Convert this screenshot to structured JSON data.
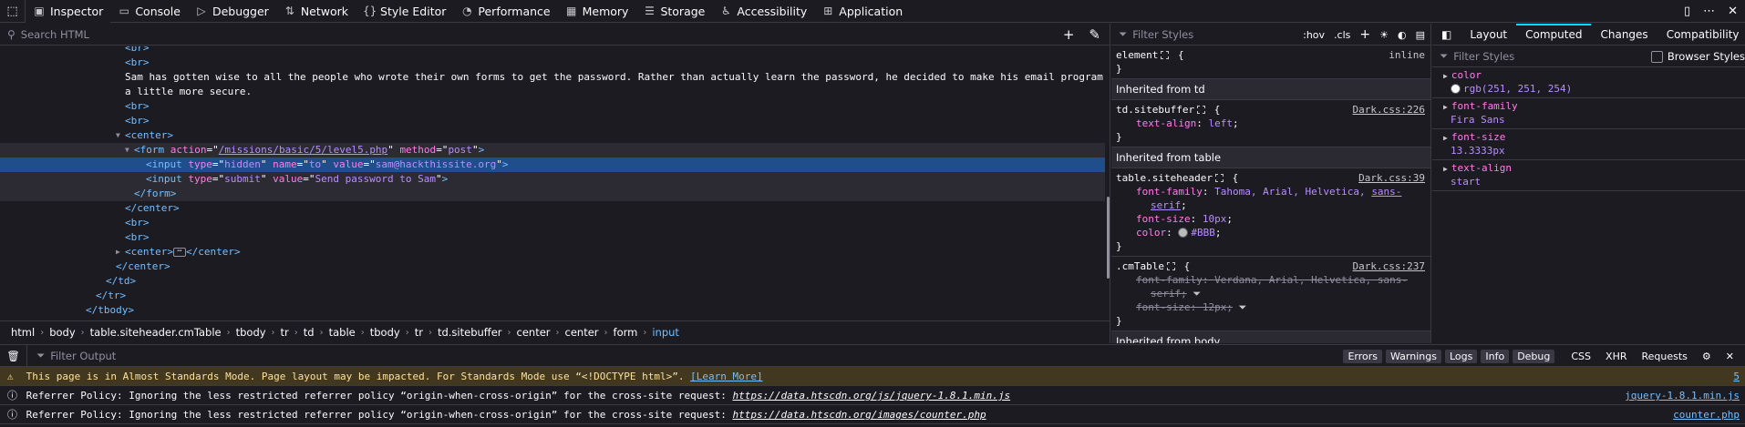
{
  "toolbar": {
    "tabs": [
      {
        "label": "Inspector",
        "icon": "inspector-icon"
      },
      {
        "label": "Console",
        "icon": "console-icon"
      },
      {
        "label": "Debugger",
        "icon": "debugger-icon"
      },
      {
        "label": "Network",
        "icon": "network-icon"
      },
      {
        "label": "Style Editor",
        "icon": "style-editor-icon"
      },
      {
        "label": "Performance",
        "icon": "performance-icon"
      },
      {
        "label": "Memory",
        "icon": "memory-icon"
      },
      {
        "label": "Storage",
        "icon": "storage-icon"
      },
      {
        "label": "Accessibility",
        "icon": "accessibility-icon"
      },
      {
        "label": "Application",
        "icon": "application-icon"
      }
    ]
  },
  "markup": {
    "search_placeholder": "Search HTML",
    "lines": {
      "br1": "<br>",
      "br2": "<br>",
      "text1": "Sam has gotten wise to all the people who wrote their own forms to get the password. Rather than actually learn the password, he decided to make his email program",
      "text2": "a little more secure.",
      "br3": "<br>",
      "br4": "<br>",
      "center_open": "<center>",
      "form_tag": "form",
      "form_action_attr": "action",
      "form_action_val": "/missions/basic/5/level5.php",
      "form_method_attr": "method",
      "form_method_val": "post",
      "input1_tag": "input",
      "input1_type_attr": "type",
      "input1_type_val": "hidden",
      "input1_name_attr": "name",
      "input1_name_val": "to",
      "input1_value_attr": "value",
      "input1_value_val": "sam@hackthissite.org",
      "input2_tag": "input",
      "input2_type_attr": "type",
      "input2_type_val": "submit",
      "input2_value_attr": "value",
      "input2_value_val": "Send password to Sam",
      "form_close": "</form>",
      "center_close": "</center>",
      "br5": "<br>",
      "br6": "<br>",
      "center_collapsed_open": "<center>",
      "center_collapsed_close": "</center>",
      "center_close2": "</center>",
      "td_close": "</td>",
      "tr_close": "</tr>",
      "tbody_close": "</tbody>"
    },
    "breadcrumbs": [
      "html",
      "body",
      "table.siteheader.cmTable",
      "tbody",
      "tr",
      "td",
      "table",
      "tbody",
      "tr",
      "td.sitebuffer",
      "center",
      "center",
      "form",
      "input"
    ]
  },
  "rules": {
    "filter_placeholder": "Filter Styles",
    "hov": ":hov",
    "cls": ".cls",
    "element": {
      "selector": "element",
      "source": "inline"
    },
    "inherited_td": "Inherited from td",
    "td_rule": {
      "selector": "td.sitebuffer",
      "source": "Dark.css:226",
      "p1": "text-align",
      "v1": "left"
    },
    "inherited_table": "Inherited from table",
    "table_rule": {
      "selector": "table.siteheader",
      "source": "Dark.css:39",
      "p1": "font-family",
      "v1a": "Tahoma, Arial, Helvetica,",
      "v1b": "sans-",
      "v1c": "serif",
      "p2": "font-size",
      "v2": "10px",
      "p3": "color",
      "v3": "#BBB"
    },
    "cmtable_rule": {
      "selector": ".cmTable",
      "source": "Dark.css:237",
      "p1": "font-family",
      "v1a": "Verdana, Arial, Helvetica, sans-",
      "v1b": "serif",
      "p2": "font-size",
      "v2": "12px"
    },
    "inherited_body": "Inherited from body"
  },
  "computed": {
    "tabs": [
      "Layout",
      "Computed",
      "Changes",
      "Compatibility"
    ],
    "filter_placeholder": "Filter Styles",
    "browser_styles": "Browser Styles",
    "props": [
      {
        "name": "color",
        "value": "rgb(251, 251, 254)"
      },
      {
        "name": "font-family",
        "value": "Fira Sans"
      },
      {
        "name": "font-size",
        "value": "13.3333px"
      },
      {
        "name": "text-align",
        "value": "start"
      }
    ]
  },
  "console": {
    "filter_placeholder": "Filter Output",
    "filters": [
      "Errors",
      "Warnings",
      "Logs",
      "Info",
      "Debug"
    ],
    "extra": [
      "CSS",
      "XHR",
      "Requests"
    ],
    "messages": [
      {
        "text": "This page is in Almost Standards Mode. Page layout may be impacted. For Standards Mode use “<!DOCTYPE html>”.",
        "link": "[Learn More]",
        "loc": "5"
      },
      {
        "text": "Referrer Policy: Ignoring the less restricted referrer policy “origin-when-cross-origin” for the cross-site request:",
        "url": "https://data.htscdn.org/js/jquery-1.8.1.min.js",
        "loc": "jquery-1.8.1.min.js"
      },
      {
        "text": "Referrer Policy: Ignoring the less restricted referrer policy “origin-when-cross-origin” for the cross-site request:",
        "url": "https://data.htscdn.org/images/counter.php",
        "loc": "counter.php"
      }
    ]
  },
  "colors": {
    "background": "#1c1b22",
    "selection": "#204e8a",
    "tag": "#75bfff",
    "attr": "#ff7de9",
    "value": "#b98eff",
    "warning_bg": "#42381f"
  }
}
